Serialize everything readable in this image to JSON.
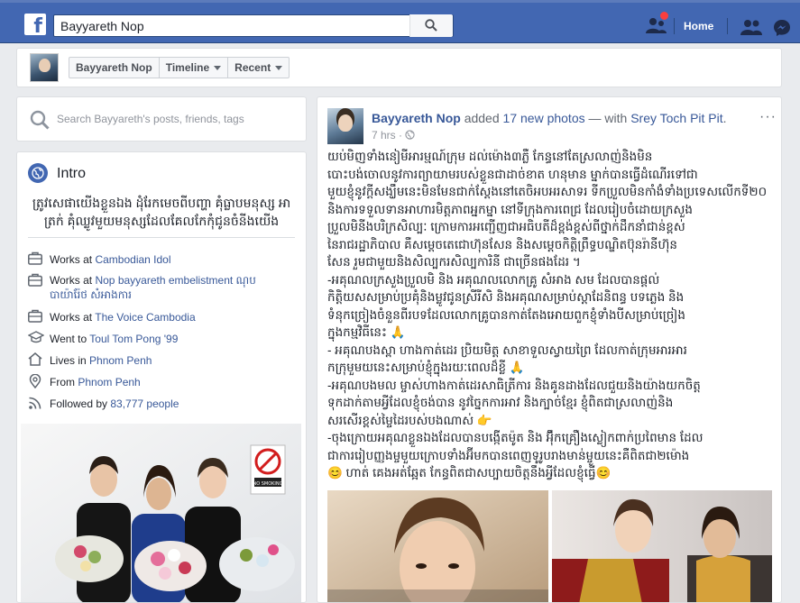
{
  "topbar": {
    "logo": "f",
    "search_value": "Bayyareth Nop",
    "home_label": "Home",
    "colors": {
      "bar": "#4267b2",
      "notification": "#fa3e3e"
    }
  },
  "subbar": {
    "profile_name": "Bayyareth Nop",
    "timeline_label": "Timeline",
    "recent_label": "Recent"
  },
  "left": {
    "search_placeholder": "Search Bayyareth's posts, friends, tags",
    "intro_title": "Intro",
    "bio": "ត្រូវសេផាយើងខ្លួនឯង ដុំរែកមេចពីបញ្ហា គុំធ្លាបមនុស្ស អាត្រក់ គុំឈ្លូវមួយមនុស្សដែលគែលកែកុំជូនចំនីងយើង",
    "info": [
      {
        "icon": "briefcase-icon",
        "prefix": "Works at",
        "link": "Cambodian Idol"
      },
      {
        "icon": "briefcase-icon",
        "prefix": "Works at",
        "link": "Nop bayyareth embelistment ណុប បាយ៉ារ៉ែថ សំអាងការ"
      },
      {
        "icon": "briefcase-icon",
        "prefix": "Works at",
        "link": "The Voice Cambodia"
      },
      {
        "icon": "graduation-cap-icon",
        "prefix": "Went to",
        "link": "Toul Tom Pong '99"
      },
      {
        "icon": "home-icon",
        "prefix": "Lives in",
        "link": "Phnom Penh"
      },
      {
        "icon": "location-pin-icon",
        "prefix": "From",
        "link": "Phnom Penh"
      },
      {
        "icon": "rss-icon",
        "prefix": "Followed by",
        "link": "83,777 people"
      }
    ],
    "no_smoking_sign": "NO SMOKING"
  },
  "post": {
    "author": "Bayyareth Nop",
    "action": "added",
    "photos_link": "17 new photos",
    "with_text": "— with",
    "tagged": "Srey Toch Pit Pit",
    "time": "7 hrs",
    "more": "···",
    "text": "យប់មិញទាំងនៀមីអារម្មណ៍ក្រុម ដល់ម៉ោង៣ភ្លឺ កែន្ធនៅតែស្រលាញ់និងមិន\nបោះបង់ចោលនូវការព្យាយាមរបស់ខ្លួនជាដាច់ខាត ហនុមាន ម្នាក់បានធ្វើដំណើរទៅជា\nមួយខ្ញុំនូវក្តីសង្ឃឹមនេះមិនមែនជាក់ស្តែងនៅតេចិអបអរសាទរ ទីកប្រួលមិនកាំងំទាំងប្រទេសលើកទី២០\nនិងការទទួលទានអាហារមិត្តភាពអ្នកម្នា នៅទីក្រុងការពេជ្រ ដែលរៀបចំដោយក្រសួង\nប្រួលមិនីងបរិក្រសិល្បៈ ក្រោមការអញ្ជើញជាអធិបតីដ៏ខ្ពង់ខ្ពស់ពីថ្នាក់ដឹកនាំជាន់ខ្ពស់\nនៃរាជរដ្ឋាភិបាល គឺសម្តេចតេជោហ៊ុនសែន និងសម្តេចកិត្តិព្រឹទ្ធបណ្ឌិតប៊ុនរ៉ានីហ៊ុន\nសែន រួមជាមួយនិងសិល្បករសិល្បការិនី ជាច្រើនផងដែរ ។\n-អគុណលក្រសួងប្រួលមិ និង អគុណលលោកគ្រូ សំអាង សម ដែលបានផ្តល់\nកិត្តិយសសម្រាប់ប្រគុំនិងម្លូវជូនស្រីរីសិ និងអគុណសម្រាប់ស្តាដែនិពន្ធ បទភ្លេង និង\nទំនុកច្រៀងចំនួនពីរបទដែលលោកគ្រូបានកាត់តែងអោយពួកខ្ញុំទាំងបីសម្រាប់ច្រៀង\nក្នុងកម្មវិធីនេះ 🙏\n- អគុណបងស្ពា ហាងកាត់ដេរ ប្រិយមិត្ត សាខាទួលស្វាយព្រៃ ដែលកាត់ក្រុមអារអារ\nកក្រុមួមយនេះសម្រាប់ខ្ញុំក្នុងរយៈពេលដ៏ខ្លី 🙏\n-អគុណបងមល ម្ចាស់ហាងកាត់ដេរសាធិត្រីការ និងគូនដាងដែលជួយនិងយ៉ាងយកចិត្ត\nទុកដាក់តាមអ្វីដែលខ្ញុំចង់បាន នូវច្នៃកការអាវ និងក្បាច់ខ្មែរ ខ្ញុំពិតជាស្រលាញ់និង\nសរសើរខ្ពស់ម្ចៃដៃរបស់បងណាស់ 👉\n-ចុងក្រោយអគុណខ្លួនឯងដែលបានបង្កើតម៉ូត និង អ៊ុឹកគ្រឿងស្លៀកពាក់ប្រពៃមាន ដែល\nជាការរៀបញ្ញងម្ចមួយក្រោបទាំងអ៊ីមកបានពេញទូរូបរាងមាន់ម្ចួយនេះគឺពិតជា២ម៉ោង\n😊 ហាត់ គេងអត់ឆ្អែត កែន្ធពិតជាសប្បាយចិត្តនឹងអ្វីដែលខ្ញុំធ្វើ😊"
  }
}
